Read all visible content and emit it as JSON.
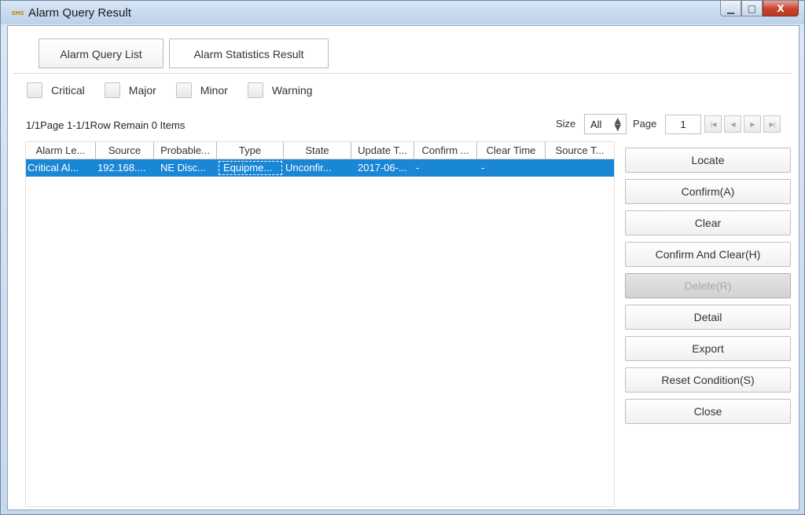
{
  "window": {
    "title": "Alarm Query Result",
    "logo_text": "EMS",
    "minimize_glyph": "▁",
    "maximize_glyph": "□",
    "close_glyph": "X"
  },
  "tabs": [
    {
      "label": "Alarm Query List",
      "active": true
    },
    {
      "label": "Alarm Statistics Result",
      "active": false
    }
  ],
  "severity_filters": [
    {
      "label": "Critical",
      "checked": false
    },
    {
      "label": "Major",
      "checked": false
    },
    {
      "label": "Minor",
      "checked": false
    },
    {
      "label": "Warning",
      "checked": false
    }
  ],
  "pagination": {
    "info": "1/1Page 1-1/1Row Remain 0 Items",
    "size_label": "Size",
    "size_value": "All",
    "size_arrow": "▲▼",
    "page_label": "Page",
    "page_value": "1",
    "nav": [
      {
        "name": "first-page-icon",
        "glyph": "|◀"
      },
      {
        "name": "prev-page-icon",
        "glyph": "◀"
      },
      {
        "name": "next-page-icon",
        "glyph": "▶"
      },
      {
        "name": "last-page-icon",
        "glyph": "▶|"
      }
    ]
  },
  "table": {
    "columns": [
      "Alarm Le...",
      "Source",
      "Probable...",
      "Type",
      "State",
      "Update T...",
      "Confirm ...",
      "Clear Time",
      "Source T..."
    ],
    "rows": [
      [
        "Critical Al...",
        "192.168....",
        "NE Disc...",
        "Equipme...",
        "Unconfir...",
        "2017-06-...",
        "-",
        "-",
        ""
      ]
    ],
    "selected_row": 0
  },
  "actions": [
    {
      "id": "locate",
      "label": "Locate",
      "enabled": true
    },
    {
      "id": "confirm",
      "label": "Confirm(A)",
      "enabled": true
    },
    {
      "id": "clear",
      "label": "Clear",
      "enabled": true
    },
    {
      "id": "confirm-and-clear",
      "label": "Confirm And Clear(H)",
      "enabled": true
    },
    {
      "id": "delete",
      "label": "Delete(R)",
      "enabled": false
    },
    {
      "id": "detail",
      "label": "Detail",
      "enabled": true
    },
    {
      "id": "export",
      "label": "Export",
      "enabled": true
    },
    {
      "id": "reset-condition",
      "label": "Reset Condition(S)",
      "enabled": true
    },
    {
      "id": "close",
      "label": "Close",
      "enabled": true
    }
  ]
}
